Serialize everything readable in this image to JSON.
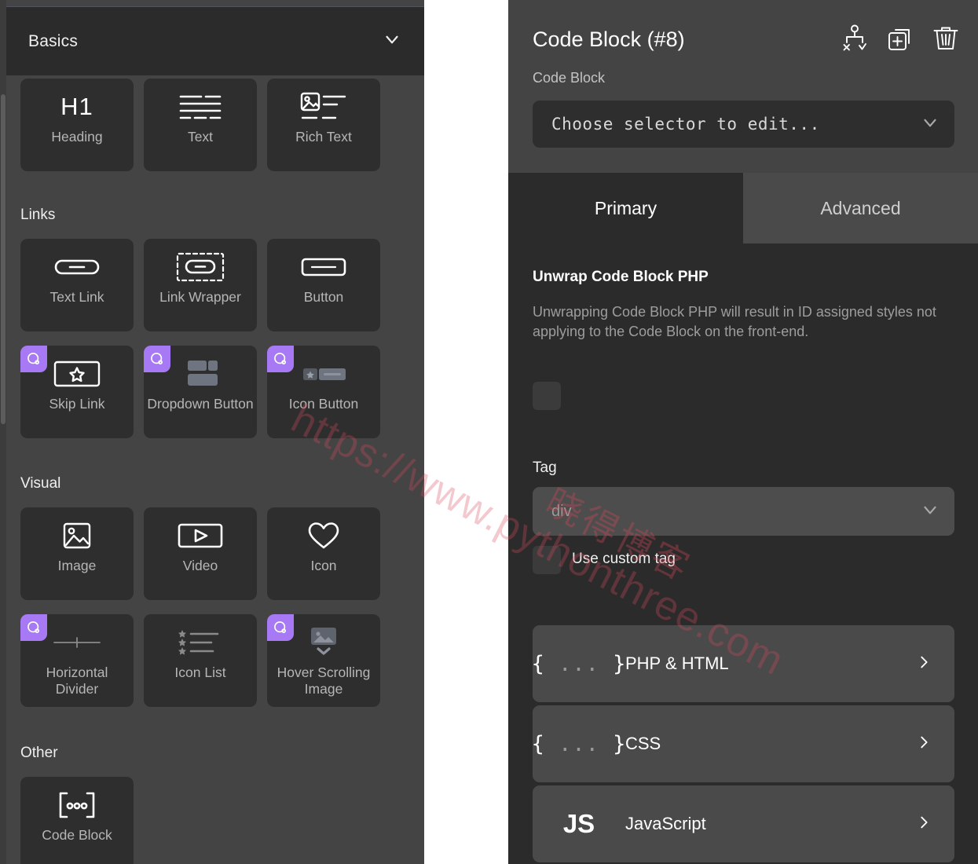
{
  "left_panel": {
    "section_header": {
      "title": "Basics",
      "chevron_icon": "chevron-down-icon"
    },
    "groups": [
      {
        "label": "",
        "tiles": [
          {
            "label": "Heading",
            "icon": "h1-icon",
            "badge": false
          },
          {
            "label": "Text",
            "icon": "text-lines-icon",
            "badge": false
          },
          {
            "label": "Rich Text",
            "icon": "rich-text-icon",
            "badge": false
          }
        ]
      },
      {
        "label": "Links",
        "tiles": [
          {
            "label": "Text Link",
            "icon": "link-chain-icon",
            "badge": false
          },
          {
            "label": "Link Wrapper",
            "icon": "link-wrapper-icon",
            "badge": false
          },
          {
            "label": "Button",
            "icon": "button-rect-icon",
            "badge": false
          },
          {
            "label": "Skip Link",
            "icon": "skip-link-star-icon",
            "badge": true
          },
          {
            "label": "Dropdown Button",
            "icon": "dropdown-button-icon",
            "badge": true
          },
          {
            "label": "Icon Button",
            "icon": "icon-button-icon",
            "badge": true
          }
        ]
      },
      {
        "label": "Visual",
        "tiles": [
          {
            "label": "Image",
            "icon": "image-icon",
            "badge": false
          },
          {
            "label": "Video",
            "icon": "video-play-icon",
            "badge": false
          },
          {
            "label": "Icon",
            "icon": "heart-icon",
            "badge": false
          },
          {
            "label": "Horizontal Divider",
            "icon": "horizontal-divider-icon",
            "badge": true
          },
          {
            "label": "Icon List",
            "icon": "icon-list-icon",
            "badge": true
          },
          {
            "label": "Hover Scrolling Image",
            "icon": "hover-scrolling-image-icon",
            "badge": true
          }
        ]
      },
      {
        "label": "Other",
        "tiles": [
          {
            "label": "Code Block",
            "icon": "code-block-icon",
            "badge": false
          }
        ]
      }
    ],
    "badge_icon": "bricks-q-icon"
  },
  "right_panel": {
    "title": "Code Block (#8)",
    "subtitle": "Code Block",
    "header_icons": [
      {
        "name": "structure-apply-icon"
      },
      {
        "name": "duplicate-add-icon"
      },
      {
        "name": "trash-icon"
      }
    ],
    "selector": {
      "value": "Choose selector to edit...",
      "chevron_icon": "chevron-down-icon"
    },
    "tabs": [
      {
        "label": "Primary",
        "active": true
      },
      {
        "label": "Advanced",
        "active": false
      }
    ],
    "unwrap": {
      "title": "Unwrap Code Block PHP",
      "description": "Unwrapping Code Block PHP will result in ID assigned styles not applying to the Code Block on the front-end.",
      "checkbox_checked": false
    },
    "tag": {
      "label": "Tag",
      "value": "div",
      "chevron_icon": "chevron-down-icon",
      "custom_tag_label": "Use custom tag",
      "custom_tag_checked": false
    },
    "code_sections": [
      {
        "label": "PHP & HTML",
        "icon": "braces-icon",
        "chevron_icon": "chevron-right-icon"
      },
      {
        "label": "CSS",
        "icon": "braces-icon",
        "chevron_icon": "chevron-right-icon"
      },
      {
        "label": "JavaScript",
        "icon": "js-icon",
        "chevron_icon": "chevron-right-icon"
      }
    ]
  },
  "watermark": {
    "url": "https://www.pythonthree.com",
    "cn": "晓得博客"
  },
  "colors": {
    "panel_bg": "#444444",
    "panel_dark": "#2b2b2b",
    "tile_bg": "#2e2e2e",
    "badge_purple": "#a779f5",
    "text_primary": "#ffffff",
    "text_muted": "#b6b6b6",
    "gap_white": "#ffffff"
  }
}
